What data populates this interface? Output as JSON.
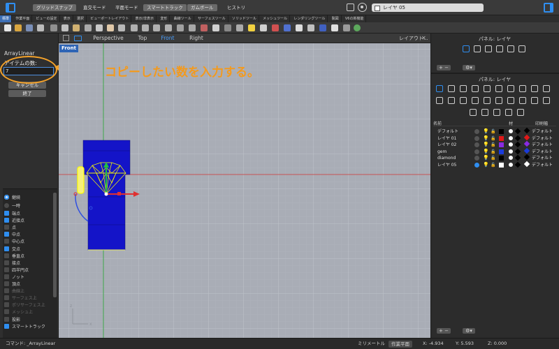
{
  "titlebar": {
    "toggles": [
      {
        "label": "グリッドスナップ",
        "on": true
      },
      {
        "label": "直交モード",
        "on": false
      },
      {
        "label": "平面モード",
        "on": false
      },
      {
        "label": "スマートトラック",
        "on": true
      },
      {
        "label": "ガムボール",
        "on": true
      },
      {
        "label": "ヒストリ",
        "on": false
      }
    ],
    "current_layer": "レイヤ 05"
  },
  "tabs": [
    "標準",
    "作業平面",
    "ビューの設定",
    "表示",
    "選択",
    "ビューポートレイアウト",
    "表示/非表示",
    "変形",
    "曲線ツール",
    "サーフェスツール",
    "ソリッドツール",
    "メッシュツール",
    "レンダリングツール",
    "製図",
    "V6の新機能"
  ],
  "viewport": {
    "tabs": [
      "Perspective",
      "Top",
      "Front",
      "Right"
    ],
    "active_tab": "Front",
    "layout_label": "レイアウト...",
    "label": "Front"
  },
  "command_panel": {
    "name": "ArrayLinear",
    "prompt": "アイテムの数:",
    "input_value": "7",
    "cancel_label": "キャンセル",
    "done_label": "終了"
  },
  "annotation": "コピーしたい数を入力する。",
  "osnap": {
    "modes": [
      {
        "label": "継続",
        "checked": true
      },
      {
        "label": "一時",
        "checked": false
      }
    ],
    "items": [
      {
        "label": "端点",
        "checked": true,
        "enabled": true
      },
      {
        "label": "近接点",
        "checked": true,
        "enabled": true
      },
      {
        "label": "点",
        "checked": false,
        "enabled": true
      },
      {
        "label": "中点",
        "checked": true,
        "enabled": true
      },
      {
        "label": "中心点",
        "checked": false,
        "enabled": true
      },
      {
        "label": "交点",
        "checked": true,
        "enabled": true
      },
      {
        "label": "垂直点",
        "checked": false,
        "enabled": true
      },
      {
        "label": "接点",
        "checked": false,
        "enabled": true
      },
      {
        "label": "四半円点",
        "checked": false,
        "enabled": true
      },
      {
        "label": "ノット",
        "checked": false,
        "enabled": true
      },
      {
        "label": "頂点",
        "checked": false,
        "enabled": true
      },
      {
        "label": "曲線上",
        "checked": false,
        "enabled": false
      },
      {
        "label": "サーフェス上",
        "checked": false,
        "enabled": false
      },
      {
        "label": "ポリサーフェス上",
        "checked": false,
        "enabled": false
      },
      {
        "label": "メッシュ上",
        "checked": false,
        "enabled": false
      },
      {
        "label": "投影",
        "checked": false,
        "enabled": true
      },
      {
        "label": "スマートトラック",
        "checked": true,
        "enabled": true
      }
    ]
  },
  "panels": {
    "top_title": "パネル: レイヤ",
    "layer_title": "パネル: レイヤ",
    "columns": {
      "name": "名前",
      "material": "材",
      "print_width": "印刷幅"
    },
    "layers": [
      {
        "name": "デフォルト",
        "current": false,
        "color": "#000000",
        "print_color": "#000000",
        "print_width": "デフォルト"
      },
      {
        "name": "レイヤ 01",
        "current": false,
        "color": "#e01818",
        "print_color": "#e01818",
        "print_width": "デフォルト"
      },
      {
        "name": "レイヤ 02",
        "current": false,
        "color": "#8a2be2",
        "print_color": "#8a2be2",
        "print_width": "デフォルト"
      },
      {
        "name": "gem",
        "current": false,
        "color": "#1a3bdc",
        "print_color": "#1a3bdc",
        "print_width": "デフォルト"
      },
      {
        "name": "diamond",
        "current": false,
        "color": "#000000",
        "print_color": "#000000",
        "print_width": "デフォルト"
      },
      {
        "name": "レイヤ 05",
        "current": true,
        "color": "#ffffff",
        "print_color": "#ffffff",
        "print_width": "デフォルト"
      }
    ]
  },
  "statusbar": {
    "command": "コマンド: _ArrayLinear",
    "units": "ミリメートル",
    "cplane": "作業平面",
    "x": "X: -4.934",
    "y": "Y: 5.593",
    "z": "Z: 0.000"
  },
  "colors": {
    "accent": "#2f8ef0",
    "annotation": "#f39a1e",
    "viewport_bg": "#a9adb6",
    "object_blue": "#1414c8",
    "selection_yellow": "#ffff00"
  }
}
